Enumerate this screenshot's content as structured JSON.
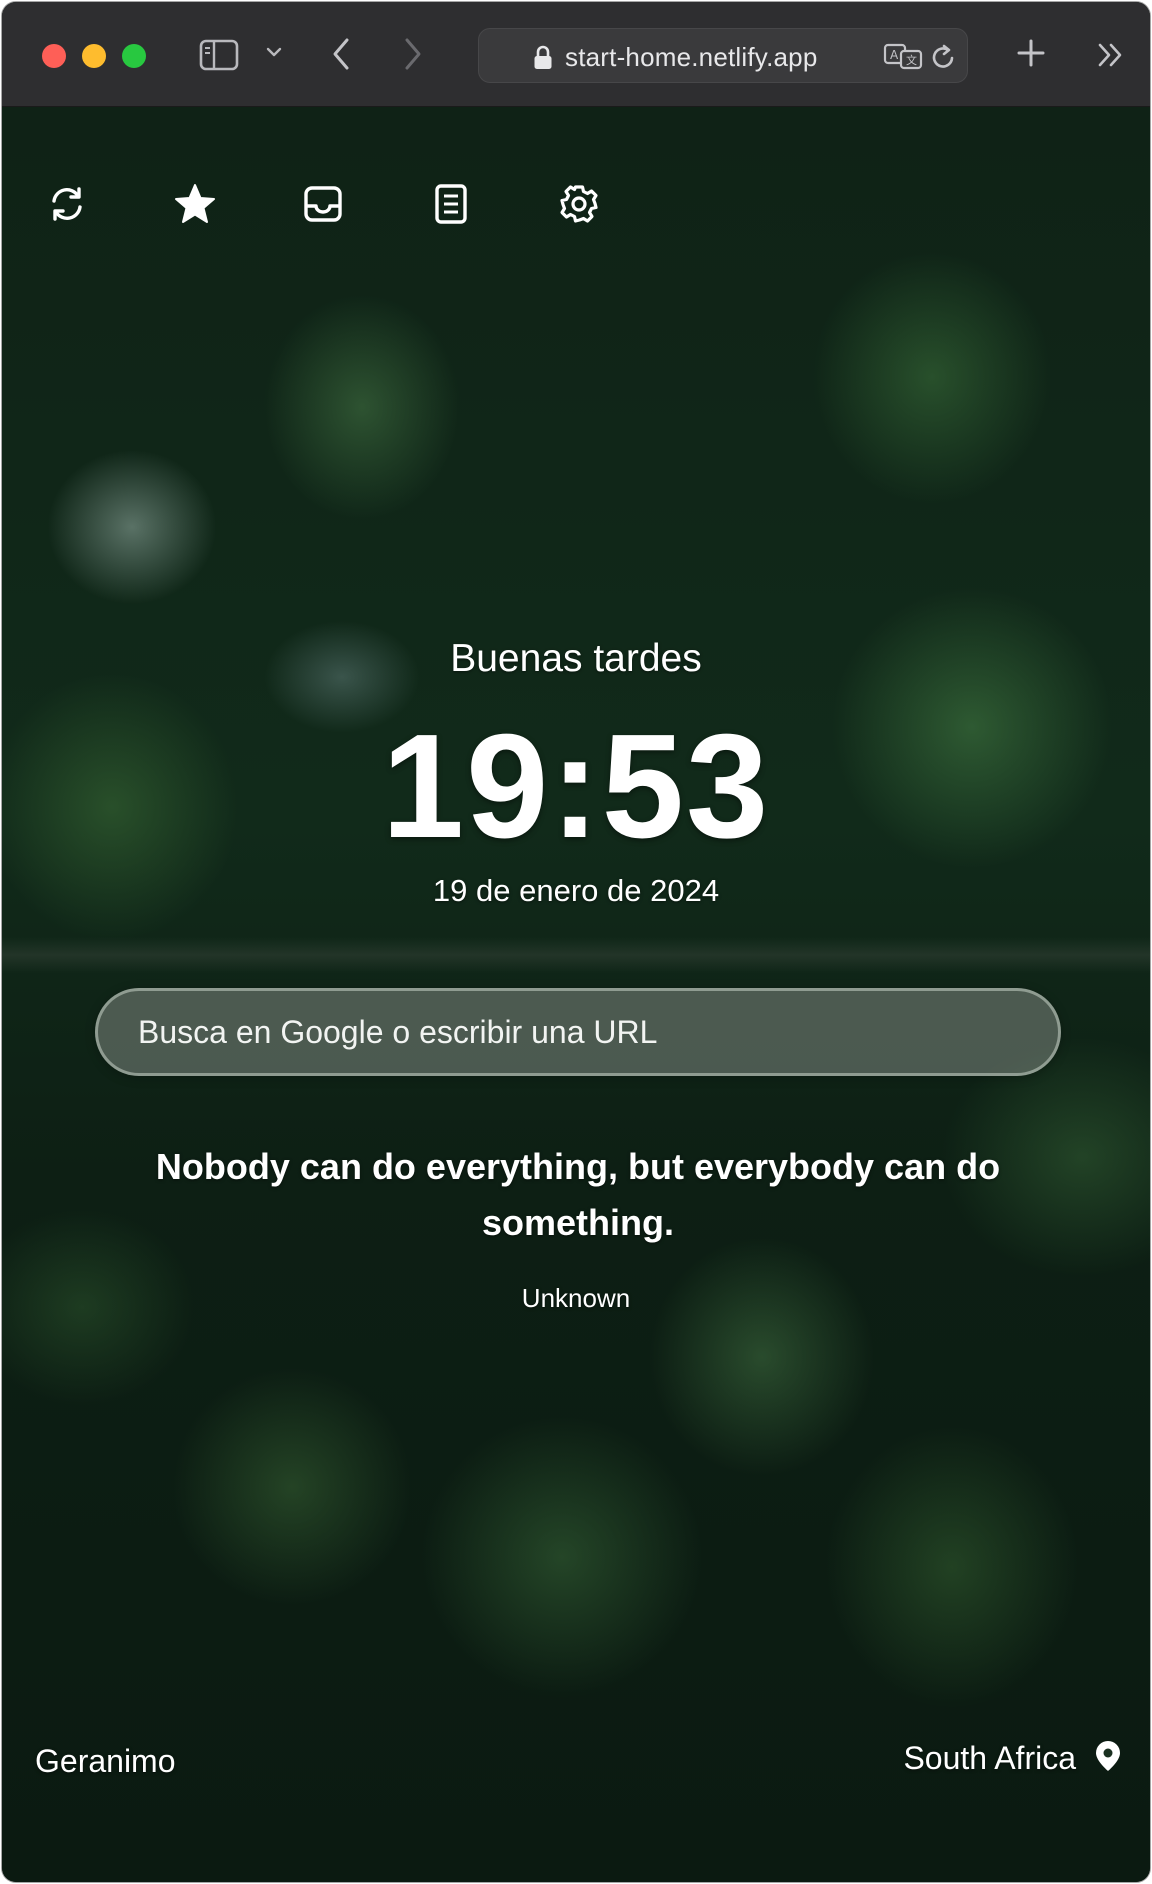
{
  "browser": {
    "url": "start-home.netlify.app",
    "icons": {
      "sidebar": "sidebar-icon",
      "tab_overview": "chevron-down-icon",
      "back": "chevron-left-icon",
      "forward": "chevron-right-icon",
      "lock": "lock-icon",
      "translate": "translate-icon",
      "reload": "reload-icon",
      "new_tab": "plus-icon",
      "more": "double-chevron-right-icon"
    },
    "traffic_colors": {
      "close": "#fe5f57",
      "minimize": "#febc2e",
      "zoom": "#28c840"
    }
  },
  "page": {
    "toolbar_icons": [
      "refresh-icon",
      "star-icon",
      "inbox-icon",
      "notes-icon",
      "gear-icon"
    ],
    "greeting": "Buenas tardes",
    "time": "19:53",
    "date": "19 de enero de 2024",
    "search": {
      "placeholder": "Busca en Google o escribir una URL",
      "value": ""
    },
    "quote": {
      "text": "Nobody can do everything, but everybody can do something.",
      "author": "Unknown"
    },
    "photo_credit": "Geranimo",
    "location": {
      "label": "South Africa",
      "icon": "map-pin-icon"
    }
  }
}
